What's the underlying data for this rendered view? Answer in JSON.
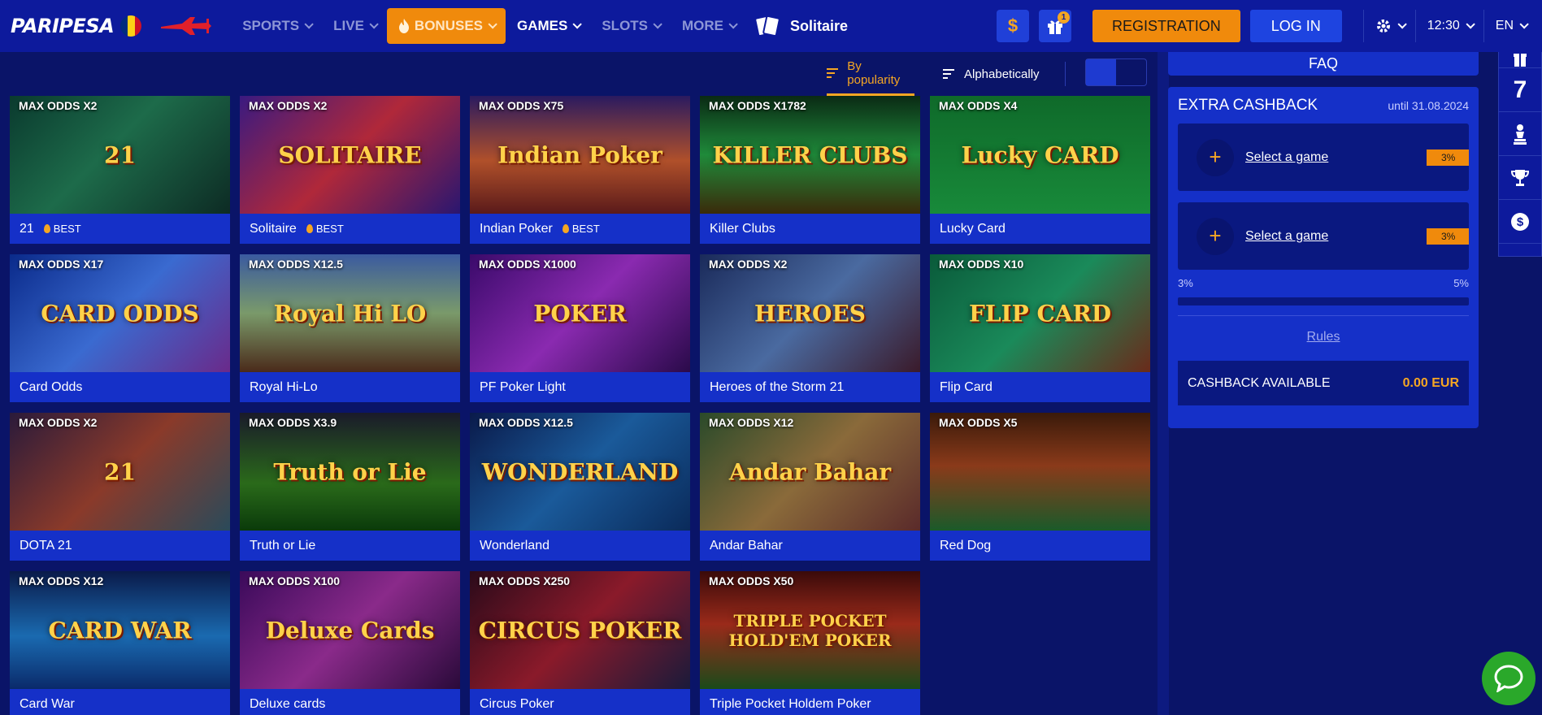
{
  "header": {
    "logo": "PARIPESA",
    "nav": [
      {
        "label": "SPORTS",
        "name": "nav-sports"
      },
      {
        "label": "LIVE",
        "name": "nav-live"
      },
      {
        "label": "BONUSES",
        "name": "nav-bonuses"
      },
      {
        "label": "GAMES",
        "name": "nav-games"
      },
      {
        "label": "SLOTS",
        "name": "nav-slots"
      },
      {
        "label": "MORE",
        "name": "nav-more"
      }
    ],
    "current_game": "Solitaire",
    "money_symbol": "$",
    "gift_count": "1",
    "registration": "REGISTRATION",
    "login": "LOG IN",
    "time": "12:30",
    "language": "EN",
    "colors": {
      "bg": "#0d1a9c",
      "accent": "#f08a0c",
      "login": "#1e44e0"
    }
  },
  "sortbar": {
    "popularity": "By popularity",
    "alphabetical": "Alphabetically"
  },
  "games": [
    {
      "title": "21",
      "odds": "MAX ODDS X2",
      "best": "BEST",
      "art": "21",
      "bg": "linear-gradient(135deg,#0a3a2e,#1d6b4a 45%,#0d2b24)"
    },
    {
      "title": "Solitaire",
      "odds": "MAX ODDS X2",
      "best": "BEST",
      "art": "SOLITAIRE",
      "bg": "linear-gradient(135deg,#3a1a80,#b0283a 50%,#2a1670)"
    },
    {
      "title": "Indian Poker",
      "odds": "MAX ODDS X75",
      "best": "BEST",
      "art": "Indian Poker",
      "bg": "linear-gradient(180deg,#2a1a60,#b0502a 55%,#5a1a1a)"
    },
    {
      "title": "Killer Clubs",
      "odds": "MAX ODDS X1782",
      "best": "",
      "art": "KILLER CLUBS",
      "bg": "linear-gradient(180deg,#0a2a14,#1f8a3a 50%,#3a2a0a)"
    },
    {
      "title": "Lucky Card",
      "odds": "MAX ODDS X4",
      "best": "",
      "art": "Lucky CARD",
      "bg": "linear-gradient(180deg,#0f6a2a,#188a3a)"
    },
    {
      "title": "Card Odds",
      "odds": "MAX ODDS X17",
      "best": "",
      "art": "CARD ODDS",
      "bg": "linear-gradient(135deg,#0a2a8a,#3a6ad0 50%,#6a2a8a)"
    },
    {
      "title": "Royal Hi-Lo",
      "odds": "MAX ODDS X12.5",
      "best": "",
      "art": "Royal Hi LO",
      "bg": "linear-gradient(180deg,#3a5aa0,#7a9a6a 50%,#4a2a1a)"
    },
    {
      "title": "PF Poker Light",
      "odds": "MAX ODDS X1000",
      "best": "",
      "art": "POKER",
      "bg": "linear-gradient(135deg,#3a0a6a,#8a2ab0 50%,#2a0a4a)"
    },
    {
      "title": "Heroes of the Storm 21",
      "odds": "MAX ODDS X2",
      "best": "",
      "art": "HEROES",
      "bg": "linear-gradient(135deg,#1a2a5a,#4a6aa0 50%,#3a1a2a)"
    },
    {
      "title": "Flip Card",
      "odds": "MAX ODDS X10",
      "best": "",
      "art": "FLIP CARD",
      "bg": "linear-gradient(135deg,#0a5a3a,#1a8a5a 50%,#6a2a1a)"
    },
    {
      "title": "DOTA 21",
      "odds": "MAX ODDS X2",
      "best": "",
      "art": "21",
      "bg": "linear-gradient(135deg,#2a1a3a,#8a3a2a 50%,#2a4a5a)"
    },
    {
      "title": "Truth or Lie",
      "odds": "MAX ODDS X3.9",
      "best": "",
      "art": "Truth or Lie",
      "bg": "linear-gradient(180deg,#1a1a2a,#2a6a1a 60%,#0a3a0a)"
    },
    {
      "title": "Wonderland",
      "odds": "MAX ODDS X12.5",
      "best": "",
      "art": "WONDERLAND",
      "bg": "linear-gradient(135deg,#0a1a4a,#1a5a9a 50%,#0a2a5a)"
    },
    {
      "title": "Andar Bahar",
      "odds": "MAX ODDS X12",
      "best": "",
      "art": "Andar Bahar",
      "bg": "linear-gradient(135deg,#2a4a2a,#8a6a3a 50%,#5a2a2a)"
    },
    {
      "title": "Red Dog",
      "odds": "MAX ODDS X5",
      "best": "",
      "art": "",
      "bg": "linear-gradient(180deg,#3a1a0a,#8a3a1a 45%,#1a5a2a)"
    },
    {
      "title": "Card War",
      "odds": "MAX ODDS X12",
      "best": "",
      "art": "CARD WAR",
      "bg": "linear-gradient(180deg,#0a1a4a,#1a6ab0 55%,#0a2a6a)"
    },
    {
      "title": "Deluxe cards",
      "odds": "MAX ODDS X100",
      "best": "",
      "art": "Deluxe Cards",
      "bg": "linear-gradient(135deg,#3a0a5a,#8a2a8a 50%,#2a0a3a)"
    },
    {
      "title": "Circus Poker",
      "odds": "MAX ODDS X250",
      "best": "",
      "art": "CIRCUS POKER",
      "bg": "linear-gradient(135deg,#2a0a1a,#8a1a2a 50%,#1a1a3a)"
    },
    {
      "title": "Triple Pocket Holdem Poker",
      "odds": "MAX ODDS X50",
      "best": "",
      "art": "TRIPLE POCKET HOLD'EM POKER",
      "bg": "linear-gradient(180deg,#3a0a0a,#9a2a1a 45%,#1a4a1a)"
    }
  ],
  "faq": "FAQ",
  "cashback": {
    "title": "EXTRA CASHBACK",
    "until": "until 31.08.2024",
    "slots": [
      {
        "label": "Select a game",
        "percent": "3%"
      },
      {
        "label": "Select a game",
        "percent": "3%"
      }
    ],
    "range_min": "3%",
    "range_max": "5%",
    "progress": 0,
    "rules": "Rules",
    "available_label": "CASHBACK AVAILABLE",
    "available_value": "0.00 EUR"
  },
  "rail": {
    "seven": "7"
  }
}
